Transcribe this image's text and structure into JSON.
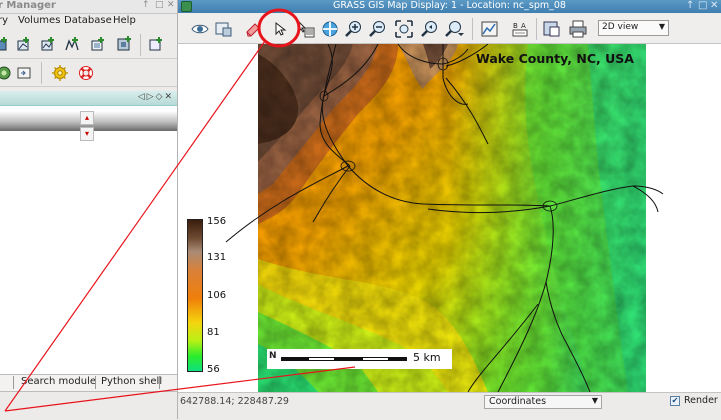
{
  "layer_manager": {
    "title": "r Manager",
    "menu": [
      "ry",
      "Volumes",
      "Database",
      "Help"
    ],
    "toolbar_icons": [
      "add-raster-icon",
      "add-vector-icon",
      "add-multiple-vector-icon",
      "add-group-icon",
      "add-overlay-icon",
      "import-icon"
    ],
    "toolbar2_icons": [
      "georectify-icon",
      "launch-script-icon",
      "settings-gear-icon",
      "help-lifebuoy-icon"
    ],
    "bottom_tabs": [
      "Search module",
      "Python shell"
    ]
  },
  "map_display": {
    "title": "GRASS GIS Map Display: 1  - Location: nc_spm_08",
    "toolbar_icons": [
      "display-eye-icon",
      "render-icon",
      "erase-icon",
      "pointer-icon",
      "query-icon",
      "pan-icon",
      "zoom-in-icon",
      "zoom-out-icon",
      "zoom-extent-icon",
      "zoom-back-icon",
      "zoom-menu-icon",
      "analyze-icon",
      "legend-text-icon",
      "save-image-icon",
      "print-icon"
    ],
    "view_mode": "2D view",
    "map_title": "Wake County, NC, USA",
    "legend": {
      "values": [
        "156",
        "131",
        "106",
        "81",
        "56"
      ]
    },
    "scalebar": {
      "north_label": "N",
      "distance_label": "5  km"
    },
    "status": {
      "coordinates": "642788.14; 228487.29",
      "mode": "Coordinates",
      "render_label": "Render",
      "render_checked": true
    }
  },
  "annotation": {
    "color": "#e8141c",
    "highlighted_tool": "pointer-icon"
  }
}
